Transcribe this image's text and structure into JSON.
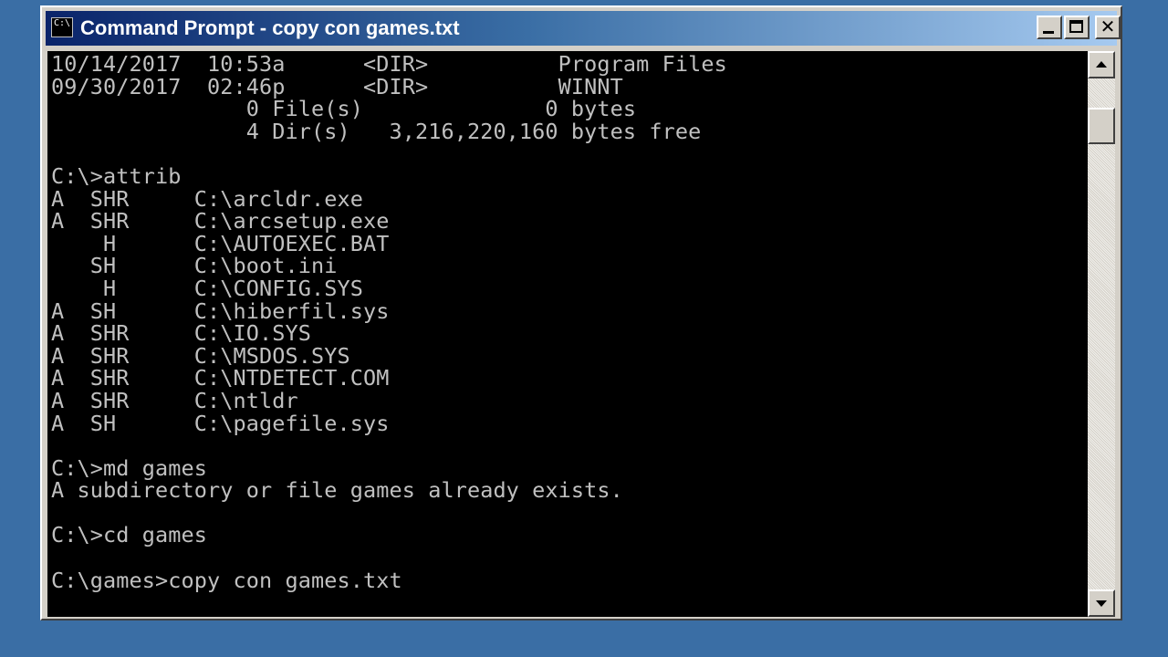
{
  "window": {
    "title": "Command Prompt - copy con games.txt",
    "icon": "console-icon",
    "icon_label": "C:\\",
    "buttons": {
      "minimize": "minimize-icon",
      "maximize": "maximize-icon",
      "close": "close-icon",
      "close_glyph": "✕"
    }
  },
  "console": {
    "foreground": "#c0c0c0",
    "background": "#000000",
    "lines": [
      "10/14/2017  10:53a      <DIR>          Program Files",
      "09/30/2017  02:46p      <DIR>          WINNT",
      "               0 File(s)              0 bytes",
      "               4 Dir(s)   3,216,220,160 bytes free",
      "",
      "C:\\>attrib",
      "A  SHR     C:\\arcldr.exe",
      "A  SHR     C:\\arcsetup.exe",
      "    H      C:\\AUTOEXEC.BAT",
      "   SH      C:\\boot.ini",
      "    H      C:\\CONFIG.SYS",
      "A  SH      C:\\hiberfil.sys",
      "A  SHR     C:\\IO.SYS",
      "A  SHR     C:\\MSDOS.SYS",
      "A  SHR     C:\\NTDETECT.COM",
      "A  SHR     C:\\ntldr",
      "A  SH      C:\\pagefile.sys",
      "",
      "C:\\>md games",
      "A subdirectory or file games already exists.",
      "",
      "C:\\>cd games",
      "",
      "C:\\games>copy con games.txt",
      ""
    ]
  },
  "scrollbar": {
    "up_icon": "scroll-up-arrow-icon",
    "down_icon": "scroll-down-arrow-icon"
  },
  "colors": {
    "desktop": "#3a6ea5",
    "titlebar_start": "#0a246a",
    "titlebar_end": "#a6caf0",
    "chrome": "#d4d0c8"
  }
}
